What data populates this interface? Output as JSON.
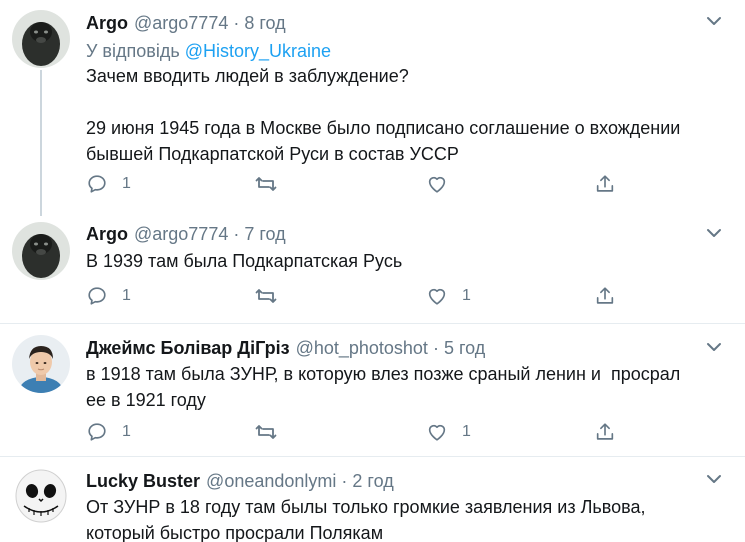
{
  "tweets": [
    {
      "name": "Argo",
      "handle": "@argo7774",
      "sep": "·",
      "time": "8 год",
      "reply_prefix": "У відповідь",
      "reply_to": "@History_Ukraine",
      "text": "Зачем вводить людей в заблуждение?\n\n29 июня 1945 года в Москве было подписано соглашение о вхождении бывшей Подкарпатской Руси в состав УССР",
      "replies": "1",
      "retweets": "",
      "likes": ""
    },
    {
      "name": "Argo",
      "handle": "@argo7774",
      "sep": "·",
      "time": "7 год",
      "text": "В 1939 там была Подкарпатская Русь",
      "replies": "1",
      "retweets": "",
      "likes": "1"
    },
    {
      "name": "Джеймс Болівар ДіГріз",
      "handle": "@hot_photoshot",
      "sep": "·",
      "time": "5 год",
      "text": "в 1918 там была ЗУНР, в которую влез позже сраный ленин и  просрал\nее в 1921 году",
      "replies": "1",
      "retweets": "",
      "likes": "1"
    },
    {
      "name": "Lucky Buster",
      "handle": "@oneandonlymi",
      "sep": "·",
      "time": "2 год",
      "text": "От ЗУНР в 18 году там былы только громкие заявления из Львова,\nкоторый быстро просрали Полякам"
    }
  ],
  "icons": {
    "reply": "comment-icon",
    "retweet": "retweet-icon",
    "like": "heart-icon",
    "share": "share-icon",
    "more": "chevron-down-icon"
  },
  "colors": {
    "link": "#1da1f2",
    "secondary_text": "#657786",
    "thread_line": "#ccd6dd",
    "divider": "#e6ecf0"
  }
}
